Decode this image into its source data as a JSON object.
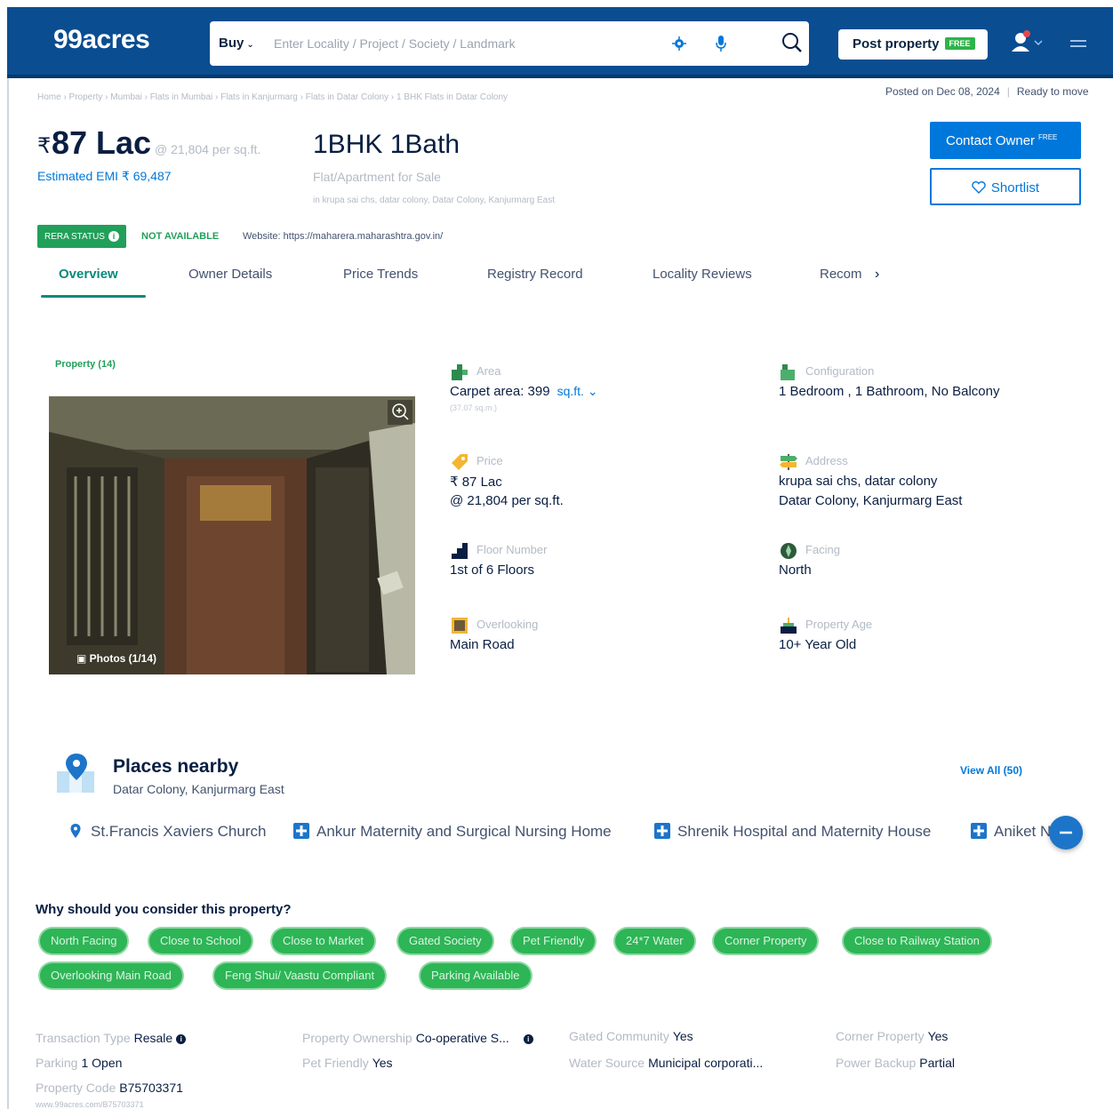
{
  "header": {
    "logo": "99acres",
    "buy_label": "Buy",
    "search_placeholder": "Enter Locality / Project / Society / Landmark",
    "post_property_label": "Post property",
    "post_property_badge": "FREE"
  },
  "breadcrumb": "Home › Property › Mumbai › Flats in Mumbai › Flats in Kanjurmarg › Flats in Datar Colony › 1 BHK Flats in Datar Colony",
  "posted": {
    "date": "Posted on Dec 08, 2024",
    "status": "Ready to move"
  },
  "listing": {
    "currency": "₹",
    "price": "87 Lac",
    "price_per_sqft": "@ 21,804 per sq.ft.",
    "emi": "Estimated EMI ₹ 69,487",
    "config": "1BHK 1Bath",
    "type": "Flat/Apartment for Sale",
    "address": "in krupa sai chs, datar colony, Datar Colony, Kanjurmarg East"
  },
  "actions": {
    "contact_owner": "Contact Owner",
    "contact_badge": "FREE",
    "shortlist": "Shortlist"
  },
  "rera": {
    "status_label": "RERA STATUS",
    "status_value": "NOT AVAILABLE",
    "website": "Website: https://maharera.maharashtra.gov.in/"
  },
  "tabs": [
    "Overview",
    "Owner Details",
    "Price Trends",
    "Registry Record",
    "Locality Reviews",
    "Recom"
  ],
  "photos": {
    "section_label": "Property (14)",
    "counter": "Photos (1/14)"
  },
  "details": {
    "area_label": "Area",
    "area_value": "Carpet area: 399",
    "area_unit": "sq.ft.",
    "area_sub": "(37.07 sq.m.)",
    "config_label": "Configuration",
    "config_value": "1 Bedroom , 1 Bathroom, No Balcony",
    "price_label": "Price",
    "price_value": "₹ 87 Lac",
    "price_value2": "@ 21,804 per sq.ft.",
    "address_label": "Address",
    "address_value": "krupa sai chs, datar colony",
    "address_value2": "Datar Colony, Kanjurmarg East",
    "floor_label": "Floor Number",
    "floor_value": "1st  of 6 Floors",
    "facing_label": "Facing",
    "facing_value": "North",
    "overlooking_label": "Overlooking",
    "overlooking_value": "Main Road",
    "age_label": "Property Age",
    "age_value": "10+ Year Old"
  },
  "places": {
    "title": "Places nearby",
    "subtitle": "Datar Colony, Kanjurmarg East",
    "view_all": "View All (50)",
    "items": [
      "St.Francis Xaviers Church",
      "Ankur Maternity and Surgical Nursing Home",
      "Shrenik Hospital and Maternity House",
      "Aniket N"
    ]
  },
  "why": {
    "title": "Why should you consider this property?",
    "chips": [
      "North Facing",
      "Close to School",
      "Close to Market",
      "Gated Society",
      "Pet Friendly",
      "24*7 Water",
      "Corner Property",
      "Close to Railway Station",
      "Overlooking Main Road",
      "Feng Shui/ Vaastu Compliant",
      "Parking Available"
    ]
  },
  "facts": {
    "transaction_k": "Transaction Type",
    "transaction_v": "Resale",
    "ownership_k": "Property Ownership",
    "ownership_v": "Co-operative S...",
    "gated_k": "Gated Community",
    "gated_v": "Yes",
    "corner_k": "Corner Property",
    "corner_v": "Yes",
    "parking_k": "Parking",
    "parking_v": "1 Open",
    "pet_k": "Pet Friendly",
    "pet_v": "Yes",
    "water_k": "Water Source",
    "water_v": "Municipal corporati...",
    "power_k": "Power Backup",
    "power_v": "Partial",
    "code_k": "Property Code",
    "code_v": "B75703371",
    "code_url": "www.99acres.com/B75703371"
  },
  "colors": {
    "header_bg": "#0a4d91",
    "accent_blue": "#0078db",
    "accent_green": "#2db556",
    "tab_active": "#0a8a7b"
  }
}
